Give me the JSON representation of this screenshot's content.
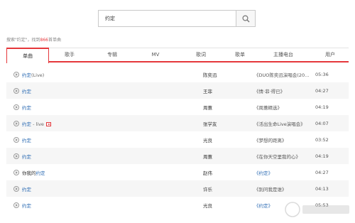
{
  "search": {
    "value": "约定"
  },
  "result": {
    "prefix": "搜索\"约定\"，找到",
    "count": "866",
    "suffix": "首单曲"
  },
  "tabs": [
    "单曲",
    "歌手",
    "专辑",
    "MV",
    "歌词",
    "歌单",
    "主播电台",
    "用户"
  ],
  "active_tab": "单曲",
  "songs": [
    {
      "title": "约定",
      "tail": "(Live)",
      "singer": "陈奕迅",
      "album": "《DUO陈奕迅演唱会(20...",
      "duration": "05:36"
    },
    {
      "title": "约定",
      "tail": "",
      "singer": "王菲",
      "album": "《情·菲·得已》",
      "duration": "04:27"
    },
    {
      "title": "约定",
      "tail": "",
      "singer": "周蕙",
      "album": "《周蕙精选》",
      "duration": "04:19"
    },
    {
      "title": "约定",
      "tail": " - live",
      "singer": "张学友",
      "album": "《活出生命Live演唱会》",
      "duration": "04:07"
    },
    {
      "title": "约定",
      "tail": "",
      "singer": "光良",
      "album": "《梦想的距离》",
      "duration": "03:52"
    },
    {
      "title": "约定",
      "tail": "",
      "singer": "周蕙",
      "album": "《在你天空里我的心》",
      "duration": "04:19"
    },
    {
      "prefix": "你我的",
      "title": "约定",
      "tail": "",
      "singer": "赵伟",
      "album": "《约定》",
      "duration": "04:27"
    },
    {
      "title": "约定",
      "tail": "",
      "singer": "许乐",
      "album": "《别问我是谁》",
      "duration": "04:13"
    },
    {
      "title": "约定",
      "tail": "",
      "singer": "光良",
      "album": "《约定》",
      "duration": "05:53"
    }
  ],
  "colors": {
    "accent": "#e5373b",
    "link": "#2a6ab3"
  }
}
